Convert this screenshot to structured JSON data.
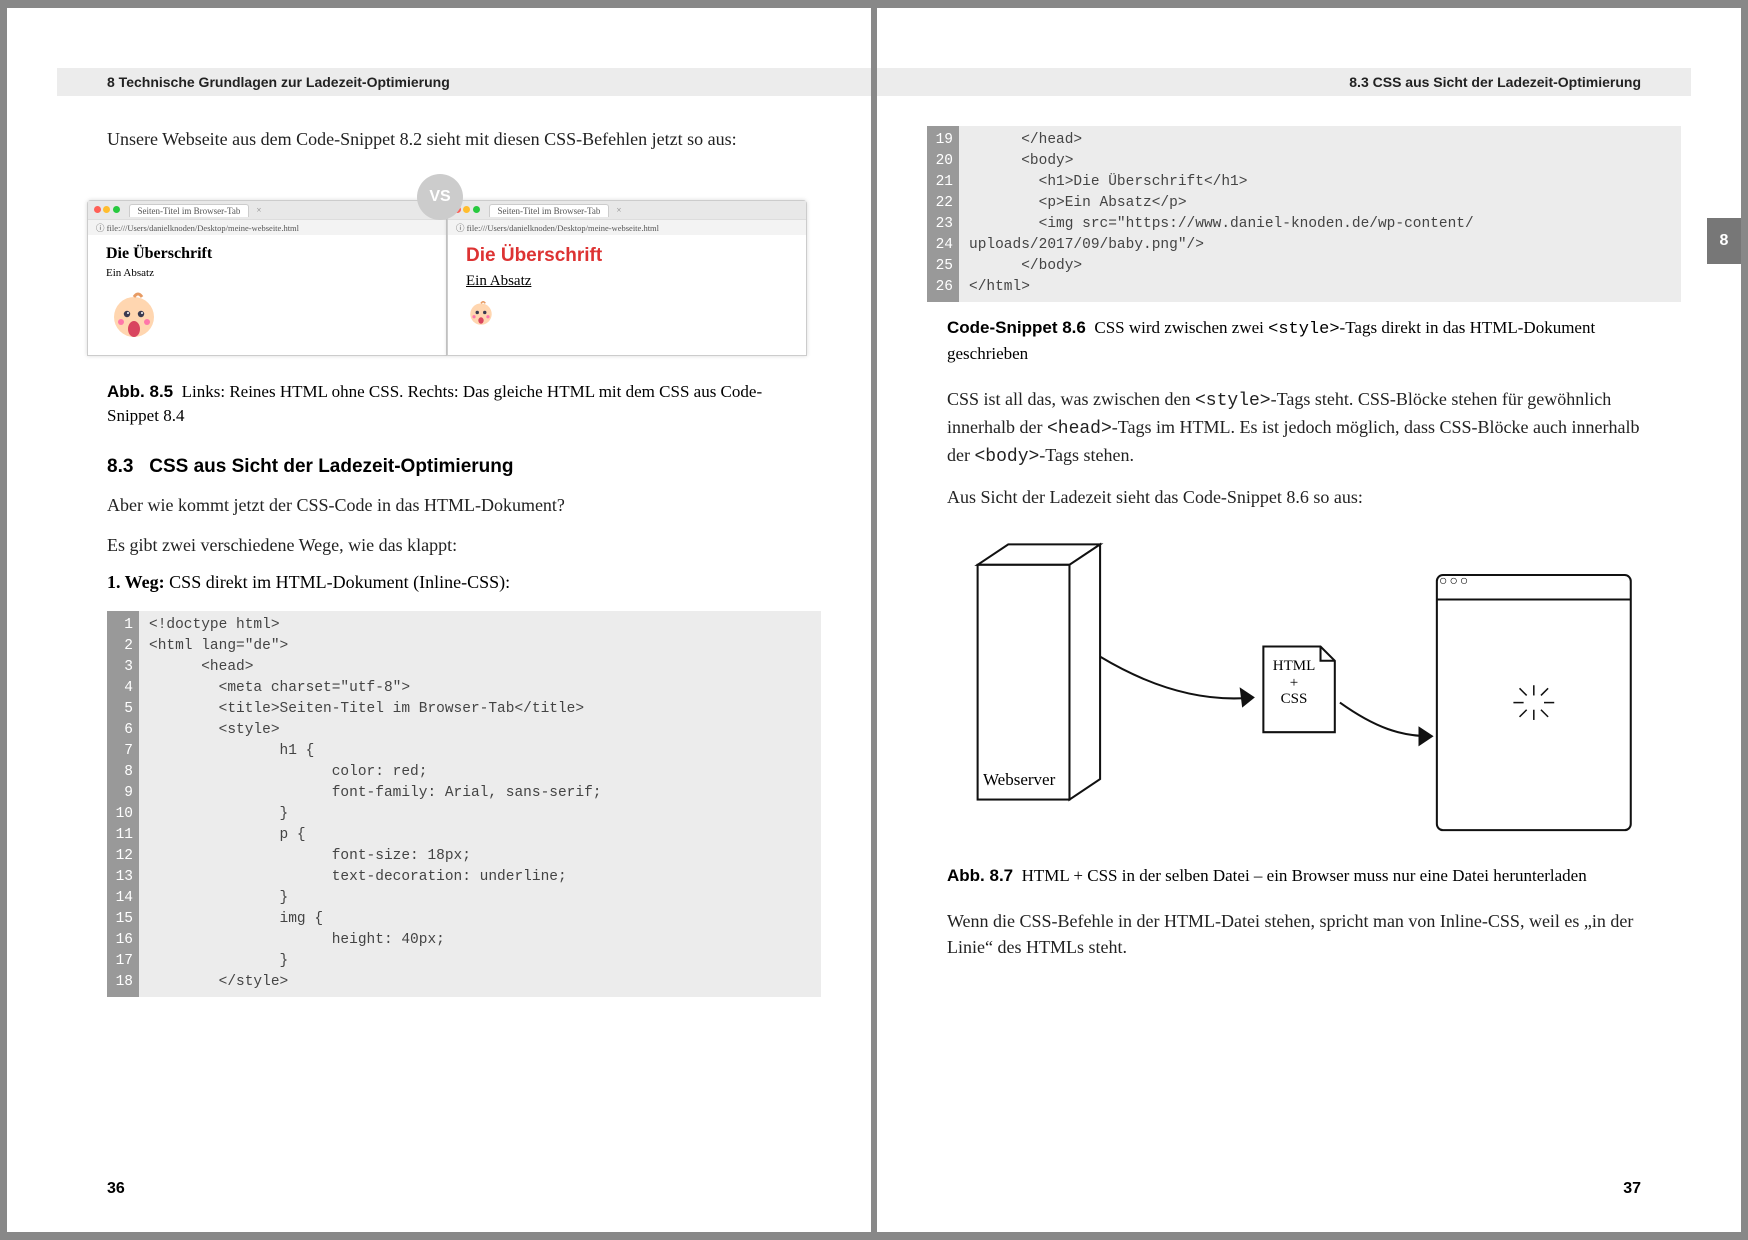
{
  "left": {
    "running_head": "8   Technische Grundlagen zur Ladezeit-Optimierung",
    "intro": "Unsere Webseite aus dem Code-Snippet 8.2 sieht mit diesen CSS-Befehlen jetzt so aus:",
    "vs_badge": "VS",
    "browser_tab": "Seiten-Titel im Browser-Tab",
    "browser_url": "file:///Users/danielknoden/Desktop/meine-webseite.html",
    "plain_heading": "Die Überschrift",
    "plain_para": "Ein Absatz",
    "css_heading": "Die Überschrift",
    "css_para": "Ein Absatz",
    "fig85_label": "Abb. 8.5",
    "fig85_caption": "Links: Reines HTML ohne CSS. Rechts: Das gleiche HTML mit dem CSS aus Code-Snippet 8.4",
    "section_num": "8.3",
    "section_title": "CSS aus Sicht der Ladezeit-Optimierung",
    "q1": "Aber wie kommt jetzt der CSS-Code in das HTML-Dokument?",
    "q2": "Es gibt zwei verschiedene Wege, wie das klappt:",
    "way1_label": "1. Weg:",
    "way1_text": "CSS direkt im HTML-Dokument (Inline-CSS):",
    "code_a": {
      "start": 1,
      "lines": [
        "<!doctype html>",
        "<html lang=\"de\">",
        "      <head>",
        "        <meta charset=\"utf-8\">",
        "        <title>Seiten-Titel im Browser-Tab</title>",
        "        <style>",
        "               h1 {",
        "                     color: red;",
        "                     font-family: Arial, sans-serif;",
        "               }",
        "               p {",
        "                     font-size: 18px;",
        "                     text-decoration: underline;",
        "               }",
        "               img {",
        "                     height: 40px;",
        "               }",
        "        </style>"
      ]
    },
    "page_number": "36"
  },
  "right": {
    "running_head": "8.3   CSS aus Sicht der Ladezeit-Optimierung",
    "thumb_tab": "8",
    "code_b": {
      "start": 19,
      "lines": [
        "      </head>",
        "      <body>",
        "        <h1>Die Überschrift</h1>",
        "        <p>Ein Absatz</p>",
        "        <img src=\"https://www.daniel-knoden.de/wp-content/",
        "uploads/2017/09/baby.png\"/>",
        "      </body>",
        "</html>"
      ]
    },
    "snip86_label": "Code-Snippet 8.6",
    "snip86_caption": "CSS wird zwischen zwei <style>-Tags direkt in das HTML-Dokument geschrieben",
    "para1": "CSS ist all das, was zwischen den <style>-Tags steht. CSS-Blöcke stehen für gewöhnlich innerhalb der <head>-Tags im HTML. Es ist jedoch möglich, dass CSS-Blöcke auch innerhalb der <body>-Tags stehen.",
    "para2": "Aus Sicht der Ladezeit sieht das Code-Snippet 8.6 so aus:",
    "diag_server": "Webserver",
    "diag_doc_line1": "HTML",
    "diag_doc_plus": "+",
    "diag_doc_line2": "CSS",
    "diag_browser_dots": "○○○",
    "fig87_label": "Abb. 8.7",
    "fig87_caption": "HTML + CSS in der selben Datei – ein Browser muss nur eine Datei herunterladen",
    "para3": "Wenn die CSS-Befehle in der HTML-Datei stehen, spricht man von Inline-CSS, weil es „in der Linie“ des HTMLs steht.",
    "page_number": "37"
  }
}
